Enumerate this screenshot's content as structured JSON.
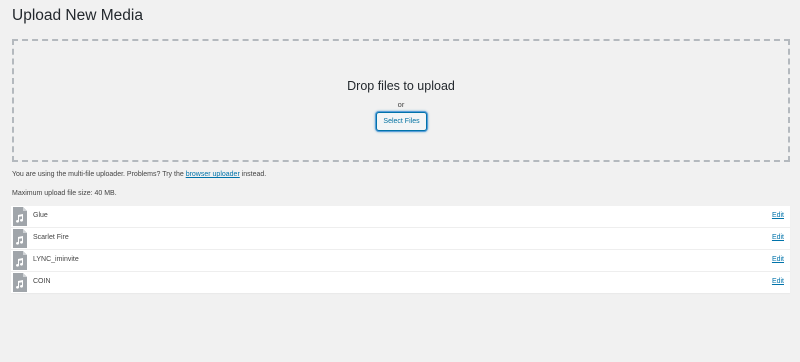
{
  "page": {
    "title": "Upload New Media"
  },
  "uploader": {
    "drop_text": "Drop files to upload",
    "or_text": "or",
    "select_button": "Select Files",
    "multi_file_text": "You are using the multi-file uploader. Problems? Try the",
    "browser_uploader_link": "browser uploader",
    "instead_text": "instead.",
    "max_size_text": "Maximum upload file size: 40 MB."
  },
  "media_items": [
    {
      "name": "Glue",
      "edit_label": "Edit",
      "icon": "audio-file-icon"
    },
    {
      "name": "Scarlet Fire",
      "edit_label": "Edit",
      "icon": "audio-file-icon"
    },
    {
      "name": "LYNC_iminvite",
      "edit_label": "Edit",
      "icon": "audio-file-icon"
    },
    {
      "name": "COIN",
      "edit_label": "Edit",
      "icon": "audio-file-icon"
    }
  ],
  "colors": {
    "background": "#f1f1f1",
    "accent": "#0073aa",
    "dashed_border": "#b4b9be",
    "icon": "#a0a5aa"
  }
}
